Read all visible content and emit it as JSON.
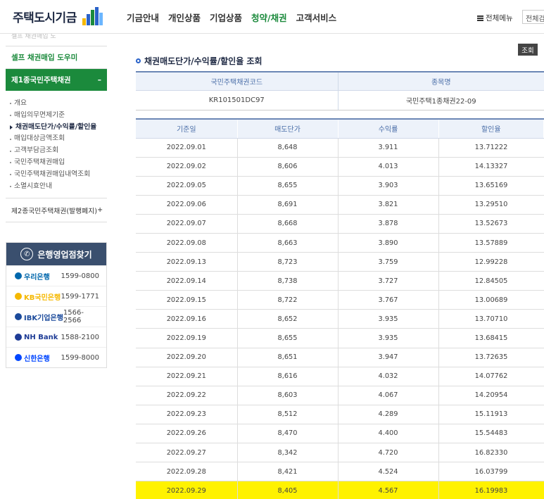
{
  "header": {
    "logo_text": "주택도시기금",
    "nav": [
      "기금안내",
      "개인상품",
      "기업상품",
      "청약/채권",
      "고객서비스"
    ],
    "active_nav_index": 3,
    "allmenu_label": "전체메뉴",
    "search_placeholder": "전체검"
  },
  "sidebar": {
    "top_cut": "셀프 채권매입 도",
    "self_link": "셀프 채권매입 도우미",
    "section1_title": "제1종국민주택채권",
    "section1_toggle": "–",
    "items": [
      "개요",
      "매입의무면제기준",
      "채권매도단가/수익률/할인율",
      "매입대상금액조회",
      "고객부담금조회",
      "국민주택채권매입",
      "국민주택채권매입내역조회",
      "소멸시효안내"
    ],
    "active_item_index": 2,
    "section2_title": "제2종국민주택채권(발행폐지)",
    "section2_toggle": "+"
  },
  "bank_finder": {
    "title": "은행영업점찾기",
    "banks": [
      {
        "name": "우리은행",
        "phone": "1599-0800",
        "color": "#0067ac"
      },
      {
        "name": "KB국민은행",
        "phone": "1599-1771",
        "color": "#f5b800"
      },
      {
        "name": "IBK기업은행",
        "phone": "1566-2566",
        "color": "#1b4a9b"
      },
      {
        "name": "NH Bank",
        "phone": "1588-2100",
        "color": "#1e3c96"
      },
      {
        "name": "신한은행",
        "phone": "1599-8000",
        "color": "#0046ff"
      }
    ]
  },
  "main": {
    "inquiry_button": "조회",
    "title": "채권매도단가/수익률/할인율 조회",
    "code_headers": [
      "국민주택채권코드",
      "종목명"
    ],
    "code_values": [
      "KR101501DC97",
      "국민주택1종채권22-09"
    ],
    "rate_headers": [
      "기준일",
      "매도단가",
      "수익률",
      "할인율"
    ],
    "rows": [
      [
        "2022.09.01",
        "8,648",
        "3.911",
        "13.71222"
      ],
      [
        "2022.09.02",
        "8,606",
        "4.013",
        "14.13327"
      ],
      [
        "2022.09.05",
        "8,655",
        "3.903",
        "13.65169"
      ],
      [
        "2022.09.06",
        "8,691",
        "3.821",
        "13.29510"
      ],
      [
        "2022.09.07",
        "8,668",
        "3.878",
        "13.52673"
      ],
      [
        "2022.09.08",
        "8,663",
        "3.890",
        "13.57889"
      ],
      [
        "2022.09.13",
        "8,723",
        "3.759",
        "12.99228"
      ],
      [
        "2022.09.14",
        "8,738",
        "3.727",
        "12.84505"
      ],
      [
        "2022.09.15",
        "8,722",
        "3.767",
        "13.00689"
      ],
      [
        "2022.09.16",
        "8,652",
        "3.935",
        "13.70710"
      ],
      [
        "2022.09.19",
        "8,655",
        "3.935",
        "13.68415"
      ],
      [
        "2022.09.20",
        "8,651",
        "3.947",
        "13.72635"
      ],
      [
        "2022.09.21",
        "8,616",
        "4.032",
        "14.07762"
      ],
      [
        "2022.09.22",
        "8,603",
        "4.067",
        "14.20954"
      ],
      [
        "2022.09.23",
        "8,512",
        "4.289",
        "15.11913"
      ],
      [
        "2022.09.26",
        "8,470",
        "4.400",
        "15.54483"
      ],
      [
        "2022.09.27",
        "8,342",
        "4.720",
        "16.82330"
      ],
      [
        "2022.09.28",
        "8,421",
        "4.524",
        "16.03799"
      ],
      [
        "2022.09.29",
        "8,405",
        "4.567",
        "16.19983"
      ]
    ],
    "highlight_row_index": 18,
    "highlight_color": "#fff200"
  }
}
